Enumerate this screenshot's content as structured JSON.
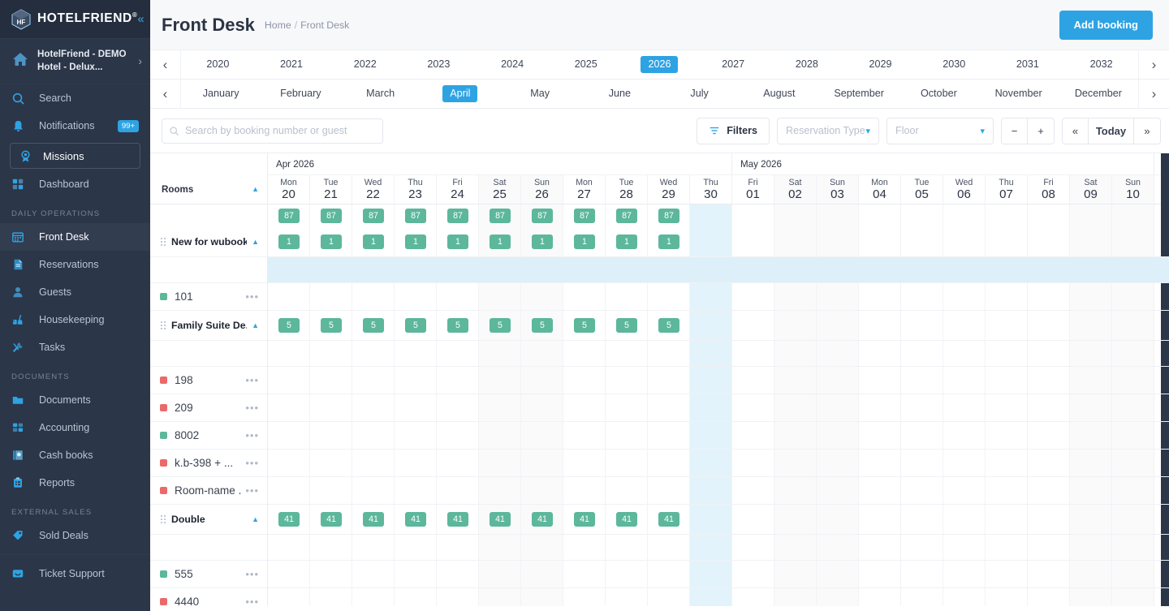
{
  "sidebar": {
    "brand": "HOTELFRIEND",
    "brand_reg": "®",
    "collapse_icon": "chevron-double-left-icon",
    "hotel": "HotelFriend - DEMO Hotel - Delux...",
    "items": [
      {
        "label": "Search",
        "icon": "search-icon",
        "type": "item"
      },
      {
        "label": "Notifications",
        "icon": "bell-icon",
        "type": "item",
        "badge": "99+"
      },
      {
        "label": "Missions",
        "icon": "award-icon",
        "type": "mission"
      },
      {
        "label": "Dashboard",
        "icon": "dashboard-grid-icon",
        "type": "item"
      },
      {
        "label": "DAILY OPERATIONS",
        "type": "group"
      },
      {
        "label": "Front Desk",
        "icon": "calendar-icon",
        "type": "item",
        "active": true
      },
      {
        "label": "Reservations",
        "icon": "document-icon",
        "type": "item"
      },
      {
        "label": "Guests",
        "icon": "user-icon",
        "type": "item"
      },
      {
        "label": "Housekeeping",
        "icon": "broom-icon",
        "type": "item"
      },
      {
        "label": "Tasks",
        "icon": "wrench-icon",
        "type": "item"
      },
      {
        "label": "DOCUMENTS",
        "type": "group"
      },
      {
        "label": "Documents",
        "icon": "folder-icon",
        "type": "item"
      },
      {
        "label": "Accounting",
        "icon": "calculator-icon",
        "type": "item"
      },
      {
        "label": "Cash books",
        "icon": "book-icon",
        "type": "item"
      },
      {
        "label": "Reports",
        "icon": "clipboard-icon",
        "type": "item"
      },
      {
        "label": "EXTERNAL SALES",
        "type": "group"
      },
      {
        "label": "Sold Deals",
        "icon": "tags-icon",
        "type": "item"
      },
      {
        "label": "Ticket Support",
        "icon": "chat-icon",
        "type": "item",
        "divider_above": true
      }
    ]
  },
  "header": {
    "title": "Front Desk",
    "breadcrumb": [
      "Home",
      "Front Desk"
    ],
    "breadcrumb_separator": "/",
    "add_booking_label": "Add booking"
  },
  "year_strip": {
    "prev_icon": "chevron-left-icon",
    "next_icon": "chevron-right-icon",
    "selected": "2026",
    "items": [
      "2020",
      "2021",
      "2022",
      "2023",
      "2024",
      "2025",
      "2026",
      "2027",
      "2028",
      "2029",
      "2030",
      "2031",
      "2032"
    ]
  },
  "month_strip": {
    "prev_icon": "chevron-left-icon",
    "next_icon": "chevron-right-icon",
    "selected": "April",
    "items": [
      "January",
      "February",
      "March",
      "April",
      "May",
      "June",
      "July",
      "August",
      "September",
      "October",
      "November",
      "December"
    ]
  },
  "toolbar": {
    "search_placeholder": "Search by booking number or guest",
    "search_value": "",
    "search_icon": "search-icon",
    "filters_label": "Filters",
    "filters_icon": "filter-icon",
    "reservation_type_label": "Reservation Type",
    "floor_label": "Floor",
    "zoom_out": "−",
    "zoom_in": "+",
    "nav_prev": "«",
    "nav_today": "Today",
    "nav_next": "»"
  },
  "calendar": {
    "rooms_header": "Rooms",
    "sort_icon": "caret-up-icon",
    "months": [
      {
        "label": "Apr 2026",
        "span": 11
      },
      {
        "label": "May 2026",
        "span": 10
      }
    ],
    "days": [
      {
        "dw": "Mon",
        "dn": "20",
        "weekend": false
      },
      {
        "dw": "Tue",
        "dn": "21",
        "weekend": false
      },
      {
        "dw": "Wed",
        "dn": "22",
        "weekend": false
      },
      {
        "dw": "Thu",
        "dn": "23",
        "weekend": false
      },
      {
        "dw": "Fri",
        "dn": "24",
        "weekend": false
      },
      {
        "dw": "Sat",
        "dn": "25",
        "weekend": true
      },
      {
        "dw": "Sun",
        "dn": "26",
        "weekend": true
      },
      {
        "dw": "Mon",
        "dn": "27",
        "weekend": false
      },
      {
        "dw": "Tue",
        "dn": "28",
        "weekend": false
      },
      {
        "dw": "Wed",
        "dn": "29",
        "weekend": false
      },
      {
        "dw": "Thu",
        "dn": "30",
        "weekend": false,
        "today": true
      },
      {
        "dw": "Fri",
        "dn": "01",
        "weekend": false
      },
      {
        "dw": "Sat",
        "dn": "02",
        "weekend": true
      },
      {
        "dw": "Sun",
        "dn": "03",
        "weekend": true
      },
      {
        "dw": "Mon",
        "dn": "04",
        "weekend": false
      },
      {
        "dw": "Tue",
        "dn": "05",
        "weekend": false
      },
      {
        "dw": "Wed",
        "dn": "06",
        "weekend": false
      },
      {
        "dw": "Thu",
        "dn": "07",
        "weekend": false
      },
      {
        "dw": "Fri",
        "dn": "08",
        "weekend": false
      },
      {
        "dw": "Sat",
        "dn": "09",
        "weekend": true
      },
      {
        "dw": "Sun",
        "dn": "10",
        "weekend": true
      }
    ],
    "rows": [
      {
        "kind": "avail",
        "values": [
          "87",
          "87",
          "87",
          "87",
          "87",
          "87",
          "87",
          "87",
          "87",
          "87"
        ]
      },
      {
        "kind": "group",
        "name": "New for wubook",
        "caret": "caret-up-icon",
        "values": [
          "1",
          "1",
          "1",
          "1",
          "1",
          "1",
          "1",
          "1",
          "1",
          "1"
        ]
      },
      {
        "kind": "spacer",
        "highlight": true
      },
      {
        "kind": "room",
        "name": "101",
        "status_color": "#5cb79b"
      },
      {
        "kind": "group",
        "name": "Family Suite De...",
        "caret": "caret-up-icon",
        "values": [
          "5",
          "5",
          "5",
          "5",
          "5",
          "5",
          "5",
          "5",
          "5",
          "5"
        ]
      },
      {
        "kind": "spacer",
        "highlight": false
      },
      {
        "kind": "room",
        "name": "198",
        "status_color": "#ea6a6a"
      },
      {
        "kind": "room",
        "name": "209",
        "status_color": "#ea6a6a"
      },
      {
        "kind": "room",
        "name": "8002",
        "status_color": "#5cb79b"
      },
      {
        "kind": "room",
        "name": "k.b-398 + ...",
        "status_color": "#ea6a6a"
      },
      {
        "kind": "room",
        "name": "Room-name ...",
        "status_color": "#ea6a6a"
      },
      {
        "kind": "group",
        "name": "Double",
        "caret": "caret-up-icon",
        "values": [
          "41",
          "41",
          "41",
          "41",
          "41",
          "41",
          "41",
          "41",
          "41",
          "41"
        ]
      },
      {
        "kind": "spacer",
        "highlight": false
      },
      {
        "kind": "room",
        "name": "555",
        "status_color": "#5cb79b"
      },
      {
        "kind": "room",
        "name": "4440",
        "status_color": "#ea6a6a"
      }
    ],
    "row_menu_icon": "ellipsis-icon",
    "drag_icon": "drag-handle-icon"
  },
  "colors": {
    "accent": "#2ea3e4",
    "sidebar_bg": "#2b3648",
    "badge_green": "#5cb79b",
    "status_red": "#ea6a6a",
    "today_highlight": "#e3f3fb"
  }
}
